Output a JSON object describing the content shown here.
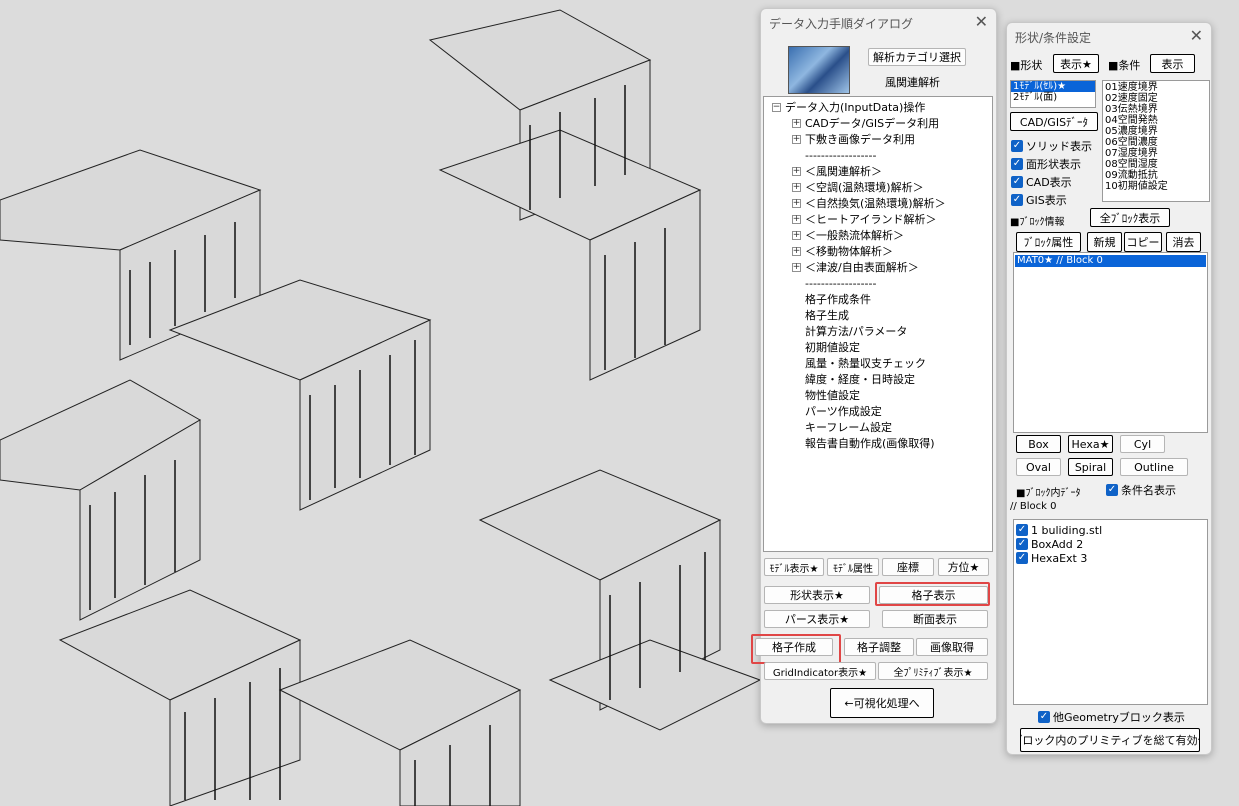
{
  "colors": {
    "accent": "#0a64d8",
    "highlight": "#e04646",
    "background": "#dcdcdc"
  },
  "viewport": {
    "description_icon": "3d-city-mesh"
  },
  "dialog1": {
    "title": "データ入力手順ダイアログ",
    "category_button": "解析カテゴリ選択",
    "category_label": "風関連解析",
    "tree": {
      "root": "データ入力(InputData)操作",
      "items": [
        "CADデータ/GISデータ利用",
        "下敷き画像データ利用",
        "------------------",
        "＜風関連解析＞",
        "＜空調(温熱環境)解析＞",
        "＜自然換気(温熱環境)解析＞",
        "＜ヒートアイランド解析＞",
        "＜一般熱流体解析＞",
        "＜移動物体解析＞",
        "＜津波/自由表面解析＞",
        "------------------",
        "格子作成条件",
        "格子生成",
        "計算方法/パラメータ",
        "初期値設定",
        "風量・熱量収支チェック",
        "緯度・経度・日時設定",
        "物性値設定",
        "パーツ作成設定",
        "キーフレーム設定",
        "報告書自動作成(画像取得)"
      ]
    },
    "buttons": {
      "model_display": "ﾓﾃﾞﾙ表示★",
      "model_attr": "ﾓﾃﾞﾙ属性",
      "coords": "座標",
      "direction": "方位★",
      "shape_display": "形状表示★",
      "grid_display": "格子表示",
      "perspective": "パース表示★",
      "section_display": "断面表示",
      "grid_create": "格子作成",
      "grid_adjust": "格子調整",
      "image_capture": "画像取得",
      "grid_indicator": "GridIndicator表示★",
      "all_primitive": "全ﾌﾟﾘﾐﾃｨﾌﾞ表示★",
      "to_visualize": "←可視化処理へ"
    }
  },
  "dialog2": {
    "title": "形状/条件設定",
    "shape_label": "■形状",
    "shape_show": "表示★",
    "cond_label": "■条件",
    "cond_show": "表示",
    "models": [
      "1ﾓﾃﾞﾙ(ｾﾙ)★",
      "2ﾓﾃﾞﾙ(面)"
    ],
    "conditions": [
      "01速度境界",
      "02速度固定",
      "03伝熱境界",
      "04空間発熱",
      "05濃度境界",
      "06空間濃度",
      "07湿度境界",
      "08空間湿度",
      "09流動抵抗",
      "10初期値設定"
    ],
    "cad_gis_button": "CAD/GISﾃﾞｰﾀ",
    "checks": [
      "ソリッド表示",
      "面形状表示",
      "CAD表示",
      "GIS表示"
    ],
    "block_info": "■ﾌﾞﾛｯｸ情報",
    "all_block": "全ﾌﾞﾛｯｸ表示",
    "block_attr": "ﾌﾞﾛｯｸ属性",
    "new": "新規",
    "copy": "コピー",
    "delete": "消去",
    "blocks": [
      "MAT0★ // Block 0"
    ],
    "primitives": [
      "Box",
      "Hexa★",
      "Cyl",
      "Oval",
      "Spiral",
      "Outline"
    ],
    "block_data_label": "■ﾌﾞﾛｯｸ内ﾃﾞｰﾀ",
    "cond_name_check": "条件名表示",
    "block_comment": "// Block 0",
    "data_items": [
      "1 buliding.stl",
      "BoxAdd 2",
      "HexaExt 3"
    ],
    "other_geometry": "他Geometryブロック表示",
    "enable_all": "ブロック内のプリミティブを総て有効化"
  }
}
